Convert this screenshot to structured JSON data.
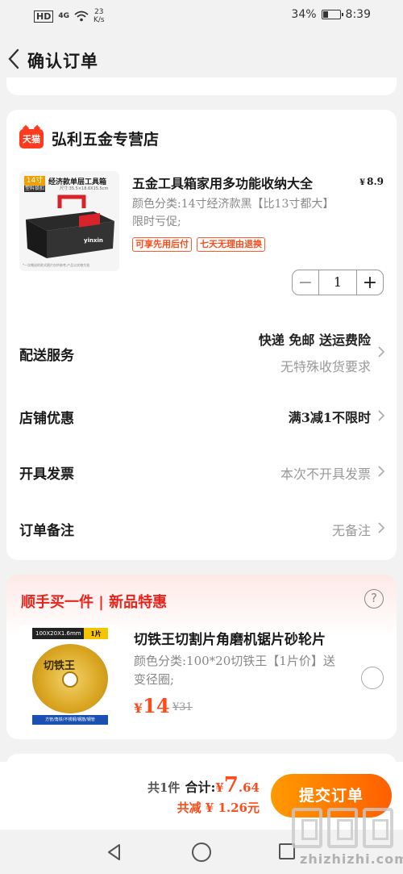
{
  "status_bar": {
    "hd": "HD",
    "signal": "4G",
    "speed_value": "23",
    "speed_unit": "K/s",
    "battery_percent": "34%",
    "battery_level": 0.34,
    "time": "8:39"
  },
  "header": {
    "title": "确认订单"
  },
  "shop": {
    "badge": "天猫",
    "name": "弘利五金专营店"
  },
  "product": {
    "image_size_badge": "14寸",
    "image_size_sub": "塑料锁扣",
    "image_caption": "经济款单层工具箱",
    "image_dims": "尺寸:35.5×18.6X15.5cm",
    "image_note": "*一次赠送的款式图片仅供参考,产品以实物为准",
    "title": "五金工具箱家用多功能收纳大全",
    "price_currency": "¥",
    "price": "8.9",
    "spec": "颜色分类:14寸经济款黑【比13寸都大】限时亏促;",
    "tags": [
      "可享先用后付",
      "七天无理由退换"
    ],
    "quantity": "1",
    "qty_minus": "−",
    "qty_plus": "+"
  },
  "rows": {
    "delivery": {
      "label": "配送服务",
      "value_line1": "快递 免邮 送运费险",
      "value_line2": "无特殊收货要求"
    },
    "discount": {
      "label": "店铺优惠",
      "value": "满3减1不限时"
    },
    "invoice": {
      "label": "开具发票",
      "value": "本次不开具发票"
    },
    "note": {
      "label": "订单备注",
      "value": "无备注"
    }
  },
  "promo": {
    "title": "顺手买一件 | 新品特惠",
    "help": "?",
    "image_spec": "100X20X1.6mm",
    "image_count": "1片",
    "image_brand": "切铁王",
    "image_footer": "方管/角铁/不锈钢/钢筋/钢管",
    "name": "切铁王切割片角磨机锯片砂轮片",
    "spec": "颜色分类:100*20切铁王【1片价】送变径圈;",
    "price_currency": "¥",
    "price": "14",
    "original_price": "¥31"
  },
  "footer": {
    "count_text": "共1件",
    "total_label": "合计:",
    "total_currency": "¥",
    "total_int": "7",
    "total_dec": ".64",
    "saved_text": "共减 ¥ 1.26元",
    "submit_label": "提交订单"
  },
  "watermark": {
    "text": "zhizhizhi.com"
  }
}
